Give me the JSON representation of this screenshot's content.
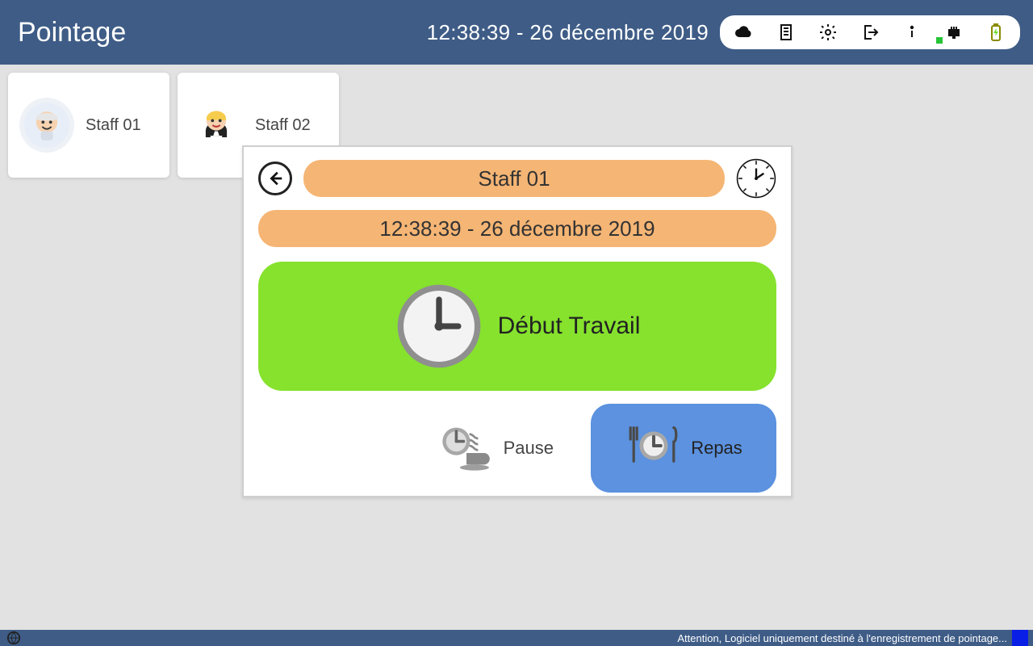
{
  "header": {
    "title": "Pointage",
    "datetime": "12:38:39 - 26 décembre 2019"
  },
  "staff": [
    {
      "name": "Staff 01",
      "avatar": "chef-male"
    },
    {
      "name": "Staff 02",
      "avatar": "waitress-female"
    }
  ],
  "popup": {
    "staff_name": "Staff 01",
    "datetime": "12:38:39 - 26 décembre 2019",
    "start_label": "Début Travail",
    "pause_label": "Pause",
    "meal_label": "Repas"
  },
  "footer": {
    "message": "Attention, Logiciel uniquement destiné à l'enregistrement de pointage..."
  },
  "colors": {
    "topbar": "#3e5c86",
    "pill": "#f5b574",
    "start": "#86e22d",
    "meal": "#5c92df"
  },
  "status_icons": [
    "cloud",
    "receipt",
    "settings",
    "logout",
    "info",
    "network",
    "battery-charging"
  ]
}
